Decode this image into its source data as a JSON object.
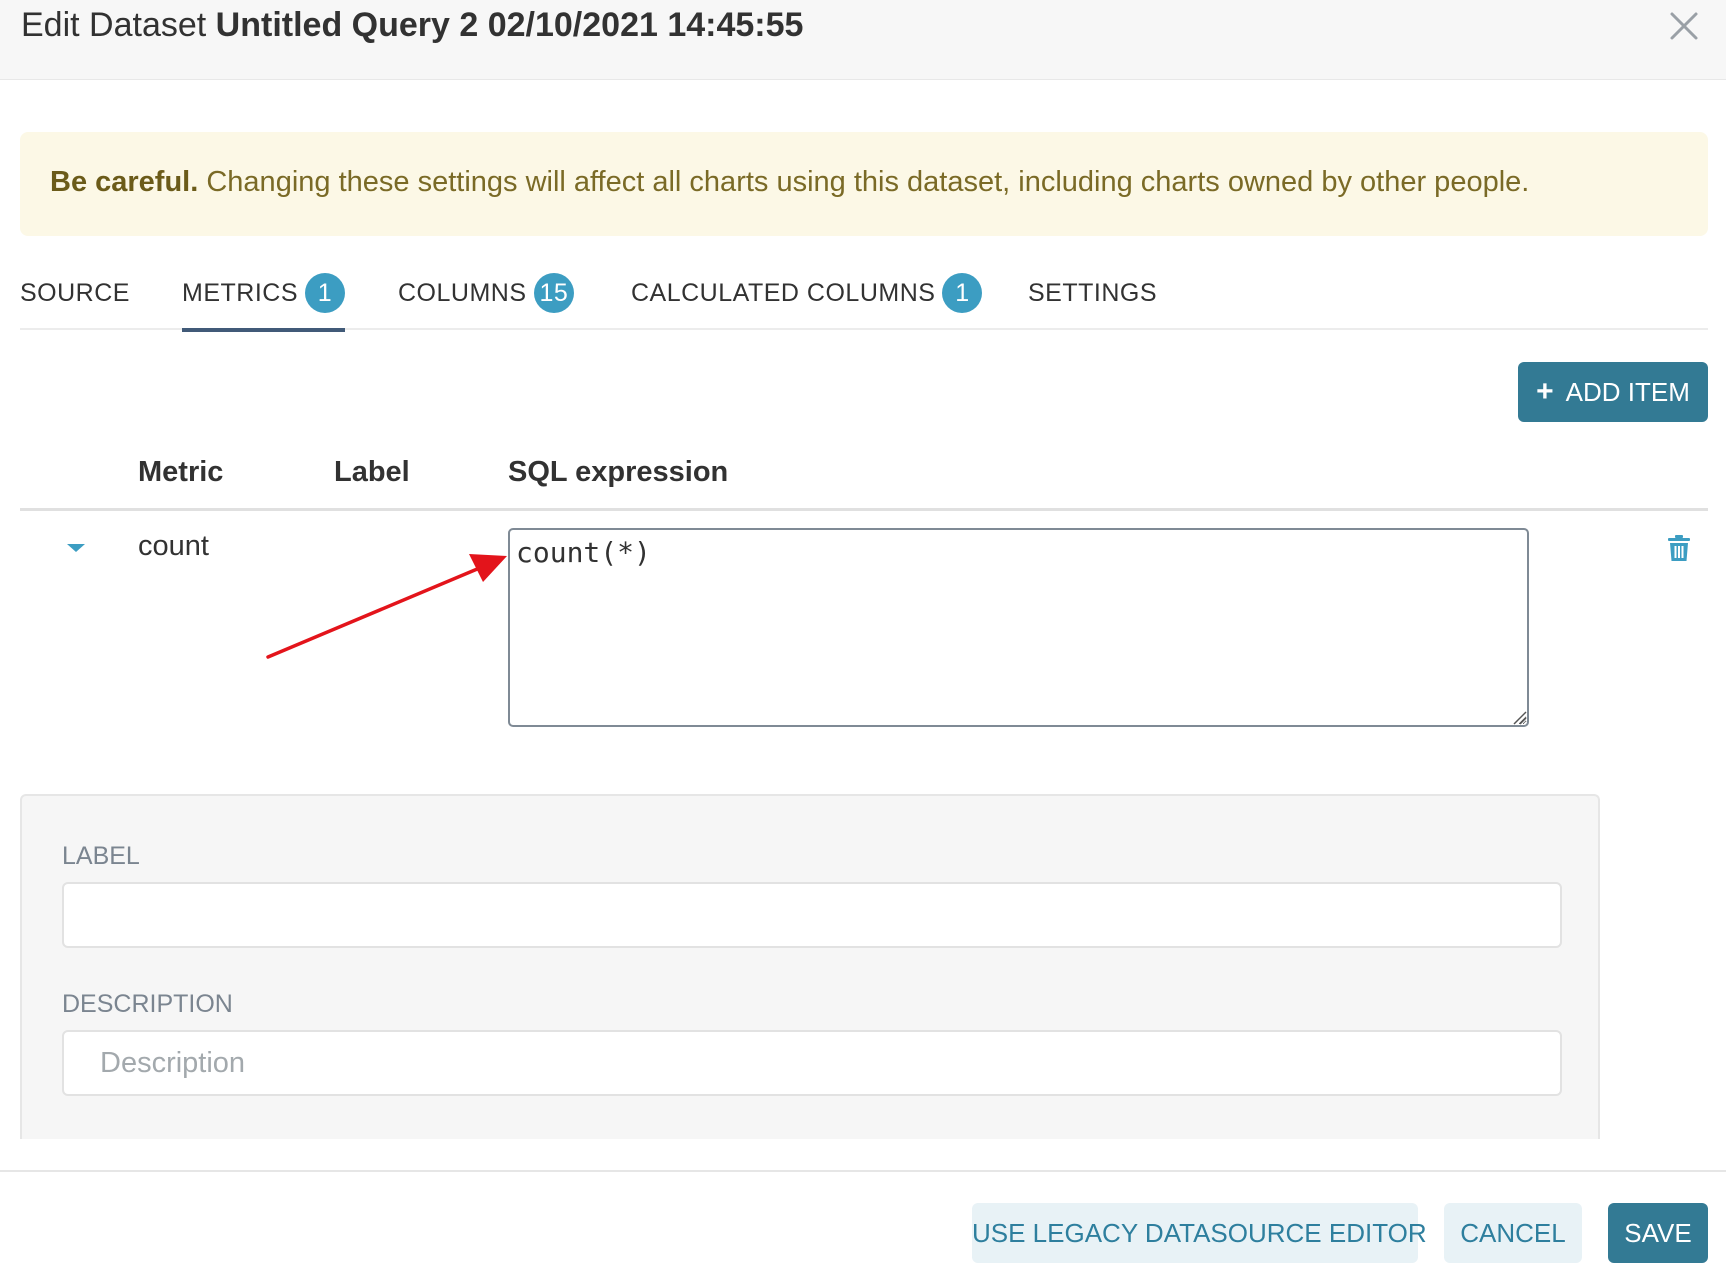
{
  "header": {
    "title_prefix": "Edit Dataset",
    "dataset_name": "Untitled Query 2 02/10/2021 14:45:55"
  },
  "alert": {
    "strong": "Be careful.",
    "text": "Changing these settings will affect all charts using this dataset, including charts owned by other people."
  },
  "tabs": [
    {
      "label": "SOURCE",
      "badge": null,
      "active": false
    },
    {
      "label": "METRICS",
      "badge": "1",
      "active": true
    },
    {
      "label": "COLUMNS",
      "badge": "15",
      "active": false
    },
    {
      "label": "CALCULATED COLUMNS",
      "badge": "1",
      "active": false
    },
    {
      "label": "SETTINGS",
      "badge": null,
      "active": false
    }
  ],
  "toolbar": {
    "add_item_label": "ADD ITEM"
  },
  "table": {
    "columns": [
      "Metric",
      "Label",
      "SQL expression"
    ],
    "rows": [
      {
        "metric": "count",
        "label": "",
        "sql": "count(*)"
      }
    ]
  },
  "details": {
    "label_field": {
      "label": "LABEL",
      "value": "",
      "placeholder": ""
    },
    "description_field": {
      "label": "DESCRIPTION",
      "value": "",
      "placeholder": "Description"
    }
  },
  "footer": {
    "legacy_label": "USE LEGACY DATASOURCE EDITOR",
    "cancel_label": "CANCEL",
    "save_label": "SAVE"
  },
  "colors": {
    "accent": "#337a94",
    "badge": "#3c9dc2",
    "alert_bg": "#fcf8e6",
    "annotation_arrow": "#e3141b"
  }
}
